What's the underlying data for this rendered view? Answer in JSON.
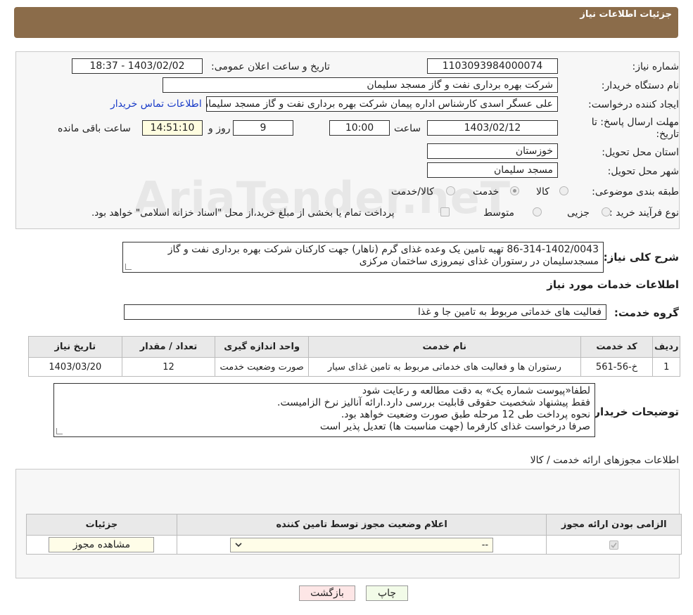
{
  "header": {
    "title": "جزئیات اطلاعات نیاز"
  },
  "form": {
    "need_number_label": "شماره نیاز:",
    "need_number": "1103093984000074",
    "announce_label": "تاریخ و ساعت اعلان عمومی:",
    "announce_value": "1403/02/02 - 18:37",
    "buyer_org_label": "نام دستگاه خریدار:",
    "buyer_org": "شرکت بهره برداری نفت و گاز مسجد سلیمان",
    "requester_label": "ایجاد کننده درخواست:",
    "requester": "علی عسگر اسدی کارشناس اداره پیمان  شرکت بهره برداری نفت و گاز مسجد سلیمان",
    "buyer_contact_link": "اطلاعات تماس خریدار",
    "deadline_label_1": "مهلت ارسال پاسخ: تا",
    "deadline_label_2": "تاریخ:",
    "deadline_date": "1403/02/12",
    "time_label": "ساعت",
    "deadline_time": "10:00",
    "days_value": "9",
    "days_label": "روز و",
    "remaining_time": "14:51:10",
    "remaining_label": "ساعت باقی مانده",
    "province_label": "استان محل تحویل:",
    "province": "خوزستان",
    "city_label": "شهر محل تحویل:",
    "city": "مسجد سلیمان",
    "category_label": "طبقه بندی موضوعی:",
    "category_options": [
      "کالا",
      "خدمت",
      "کالا/خدمت"
    ],
    "category_selected": "خدمت",
    "process_label": "نوع فرآیند خرید :",
    "process_options": [
      "جزیی",
      "متوسط"
    ],
    "payment_note": "پرداخت تمام یا بخشی از مبلغ خرید،از محل \"اسناد خزانه اسلامی\" خواهد بود."
  },
  "summary": {
    "label": "شرح کلی نیاز:",
    "text": "86-314-1402/0043  تهیه تامین یک وعده غذای گرم (ناهار) جهت کارکنان شرکت بهره برداری نفت و گاز مسجدسلیمان در رستوران غذای نیمروزی ساختمان مرکزی"
  },
  "services": {
    "section_title": "اطلاعات خدمات مورد نیاز",
    "group_label": "گروه خدمت:",
    "group_value": "فعالیت های خدماتی مربوط به تامین جا و غذا",
    "columns": [
      "ردیف",
      "کد خدمت",
      "نام خدمت",
      "واحد اندازه گیری",
      "تعداد / مقدار",
      "تاریخ نیاز"
    ],
    "rows": [
      {
        "row": "1",
        "code": "خ-56-561",
        "name": "رستوران ها و فعالیت های خدماتی مربوط به تامین غذای سیار",
        "unit": "صورت وضعیت خدمت",
        "qty": "12",
        "date": "1403/03/20"
      }
    ]
  },
  "buyer_notes": {
    "label": "توضیحات خریدار:",
    "lines": [
      "لطفا«پیوست شماره یک» به دقت مطالعه و رعایت شود",
      "فقط پیشنهاد شخصیت حقوقی قابلیت بررسی دارد.ارائه آنالیز نرخ الزامیست.",
      "نحوه پرداخت طی 12 مرحله طبق صورت وضعیت خواهد بود.",
      "صرفا درخواست غذای کارفرما (جهت مناسبت ها) تعدیل پذیر است"
    ]
  },
  "permits": {
    "section_title": "اطلاعات مجوزهای ارائه خدمت / کالا",
    "columns": [
      "الزامی بودن ارائه مجوز",
      "اعلام وضعیت مجوز توسط تامین کننده",
      "جزئیات"
    ],
    "select_value": "--",
    "view_button": "مشاهده مجوز"
  },
  "footer": {
    "print_button": "چاپ",
    "back_button": "بازگشت"
  },
  "watermark": "AriaTender.neT"
}
